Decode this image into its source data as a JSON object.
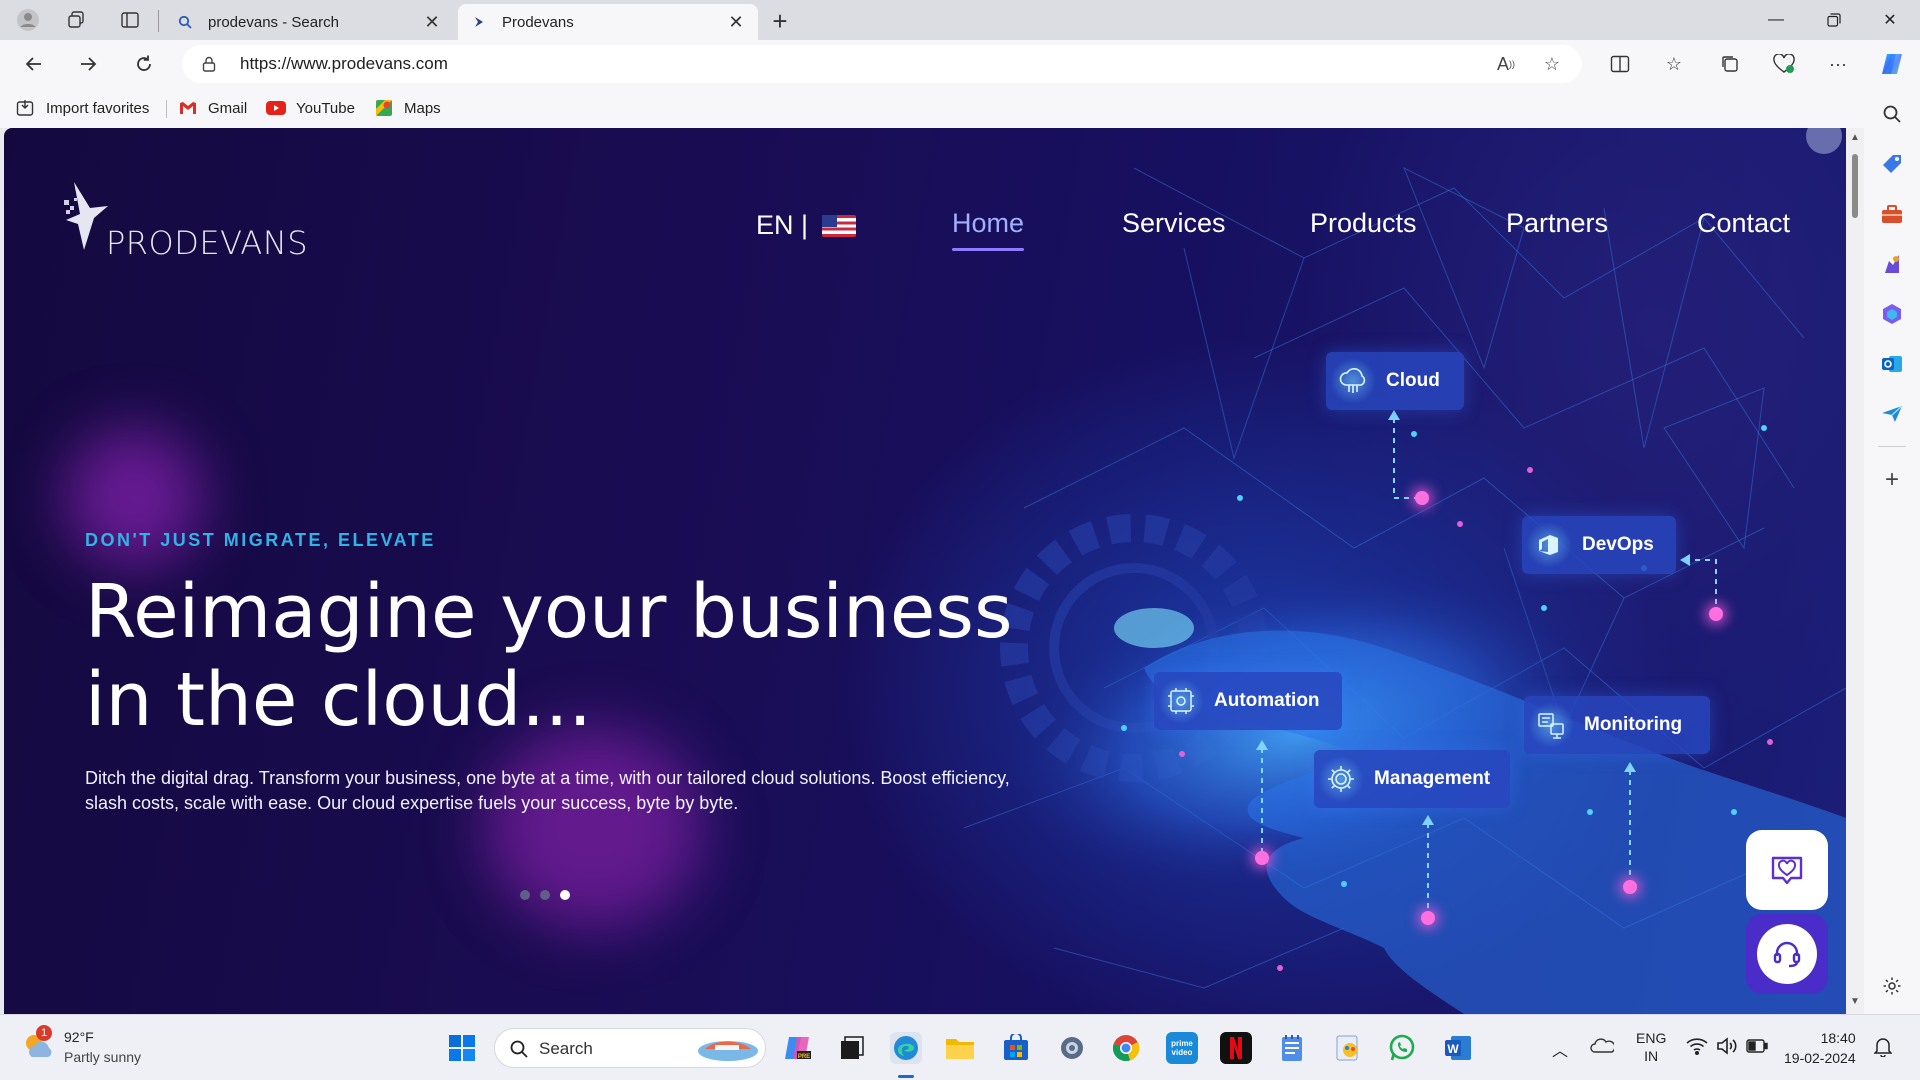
{
  "browser": {
    "tabs": [
      {
        "title": "prodevans - Search",
        "active": false
      },
      {
        "title": "Prodevans",
        "active": true
      }
    ],
    "url": "https://www.prodevans.com",
    "favorites": [
      {
        "label": "Import favorites",
        "icon": "import-icon"
      },
      {
        "label": "Gmail",
        "icon": "gmail-icon"
      },
      {
        "label": "YouTube",
        "icon": "youtube-icon"
      },
      {
        "label": "Maps",
        "icon": "maps-icon"
      }
    ]
  },
  "site": {
    "brand": "PRODEVANS",
    "language": "EN |",
    "nav": [
      "Home",
      "Services",
      "Products",
      "Partners",
      "Contact"
    ],
    "active_nav": "Home",
    "hero": {
      "eyebrow": "DON'T JUST MIGRATE, ELEVATE",
      "headline": "Reimagine your business in the cloud...",
      "description": "Ditch the digital drag. Transform your business, one byte at a time, with our tailored cloud solutions. Boost efficiency, slash costs, scale with ease. Our cloud expertise fuels your success, byte by byte.",
      "slide_count": 3,
      "active_slide": 3
    },
    "services": [
      "Cloud",
      "DevOps",
      "Automation",
      "Monitoring",
      "Management"
    ]
  },
  "taskbar": {
    "weather": {
      "temp": "92°F",
      "condition": "Partly sunny",
      "badge": "1"
    },
    "search_label": "Search",
    "language": "ENG",
    "region": "IN",
    "time": "18:40",
    "date": "19-02-2024"
  },
  "colors": {
    "accent_cyan": "#2fb4e6",
    "nav_active": "#9fb0ff",
    "node_pink": "#ff6fe0",
    "chip_blue": "#2846be"
  }
}
